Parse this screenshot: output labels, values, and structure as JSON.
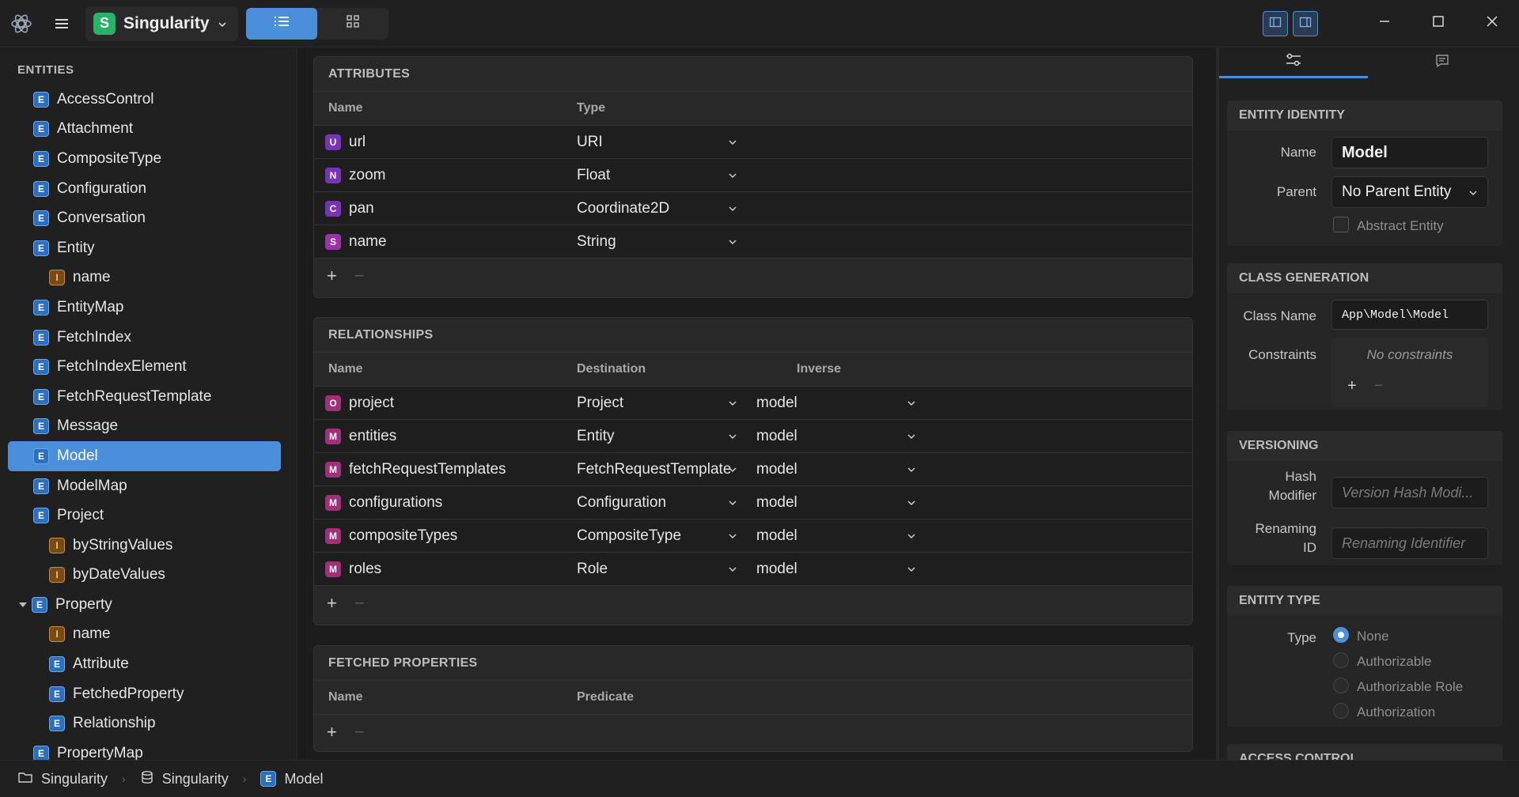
{
  "titlebar": {
    "project_badge": "S",
    "project_name": "Singularity",
    "project_color": "#27b36a",
    "accent": "#4a8fd9"
  },
  "sidebar": {
    "header": "ENTITIES",
    "items": [
      {
        "badge": "E",
        "label": "AccessControl",
        "indent": 0
      },
      {
        "badge": "E",
        "label": "Attachment",
        "indent": 0
      },
      {
        "badge": "E",
        "label": "CompositeType",
        "indent": 0
      },
      {
        "badge": "E",
        "label": "Configuration",
        "indent": 0
      },
      {
        "badge": "E",
        "label": "Conversation",
        "indent": 0
      },
      {
        "badge": "E",
        "label": "Entity",
        "indent": 0
      },
      {
        "badge": "I",
        "label": "name",
        "indent": 1
      },
      {
        "badge": "E",
        "label": "EntityMap",
        "indent": 0
      },
      {
        "badge": "E",
        "label": "FetchIndex",
        "indent": 0
      },
      {
        "badge": "E",
        "label": "FetchIndexElement",
        "indent": 0
      },
      {
        "badge": "E",
        "label": "FetchRequestTemplate",
        "indent": 0
      },
      {
        "badge": "E",
        "label": "Message",
        "indent": 0
      },
      {
        "badge": "E",
        "label": "Model",
        "indent": 0,
        "selected": true
      },
      {
        "badge": "E",
        "label": "ModelMap",
        "indent": 0
      },
      {
        "badge": "E",
        "label": "Project",
        "indent": 0
      },
      {
        "badge": "I",
        "label": "byStringValues",
        "indent": 1
      },
      {
        "badge": "I",
        "label": "byDateValues",
        "indent": 1
      },
      {
        "badge": "E",
        "label": "Property",
        "indent": 0,
        "expanded": true
      },
      {
        "badge": "I",
        "label": "name",
        "indent": 1
      },
      {
        "badge": "E",
        "label": "Attribute",
        "indent": 1
      },
      {
        "badge": "E",
        "label": "FetchedProperty",
        "indent": 1
      },
      {
        "badge": "E",
        "label": "Relationship",
        "indent": 1
      },
      {
        "badge": "E",
        "label": "PropertyMap",
        "indent": 0
      }
    ]
  },
  "attributes": {
    "title": "ATTRIBUTES",
    "col_name": "Name",
    "col_type": "Type",
    "rows": [
      {
        "badge": "U",
        "name": "url",
        "type": "URI"
      },
      {
        "badge": "N",
        "name": "zoom",
        "type": "Float"
      },
      {
        "badge": "C",
        "name": "pan",
        "type": "Coordinate2D"
      },
      {
        "badge": "S",
        "name": "name",
        "type": "String"
      }
    ]
  },
  "relationships": {
    "title": "RELATIONSHIPS",
    "col_name": "Name",
    "col_destination": "Destination",
    "col_inverse": "Inverse",
    "rows": [
      {
        "badge": "O",
        "name": "project",
        "destination": "Project",
        "inverse": "model"
      },
      {
        "badge": "M",
        "name": "entities",
        "destination": "Entity",
        "inverse": "model"
      },
      {
        "badge": "M",
        "name": "fetchRequestTemplates",
        "destination": "FetchRequestTemplate",
        "inverse": "model"
      },
      {
        "badge": "M",
        "name": "configurations",
        "destination": "Configuration",
        "inverse": "model"
      },
      {
        "badge": "M",
        "name": "compositeTypes",
        "destination": "CompositeType",
        "inverse": "model"
      },
      {
        "badge": "M",
        "name": "roles",
        "destination": "Role",
        "inverse": "model"
      }
    ]
  },
  "fetched": {
    "title": "FETCHED PROPERTIES",
    "col_name": "Name",
    "col_predicate": "Predicate"
  },
  "controls": {
    "plus": "+",
    "minus": "−"
  },
  "inspector": {
    "identity": {
      "title": "ENTITY IDENTITY",
      "name_label": "Name",
      "name_value": "Model",
      "parent_label": "Parent",
      "parent_value": "No Parent Entity",
      "abstract_label": "Abstract Entity"
    },
    "classgen": {
      "title": "CLASS GENERATION",
      "class_label": "Class Name",
      "class_value": "App\\Model\\Model",
      "constraints_label": "Constraints",
      "constraints_empty": "No constraints"
    },
    "versioning": {
      "title": "VERSIONING",
      "hash_label_1": "Hash",
      "hash_label_2": "Modifier",
      "hash_placeholder": "Version Hash Modi...",
      "renaming_label_1": "Renaming",
      "renaming_label_2": "ID",
      "renaming_placeholder": "Renaming Identifier"
    },
    "entitytype": {
      "title": "ENTITY TYPE",
      "type_label": "Type",
      "options": [
        "None",
        "Authorizable",
        "Authorizable Role",
        "Authorization"
      ],
      "selected": "None"
    },
    "next_title": "ACCESS CONTROL"
  },
  "statusbar": {
    "crumbs": [
      "Singularity",
      "Singularity",
      "Model"
    ]
  }
}
